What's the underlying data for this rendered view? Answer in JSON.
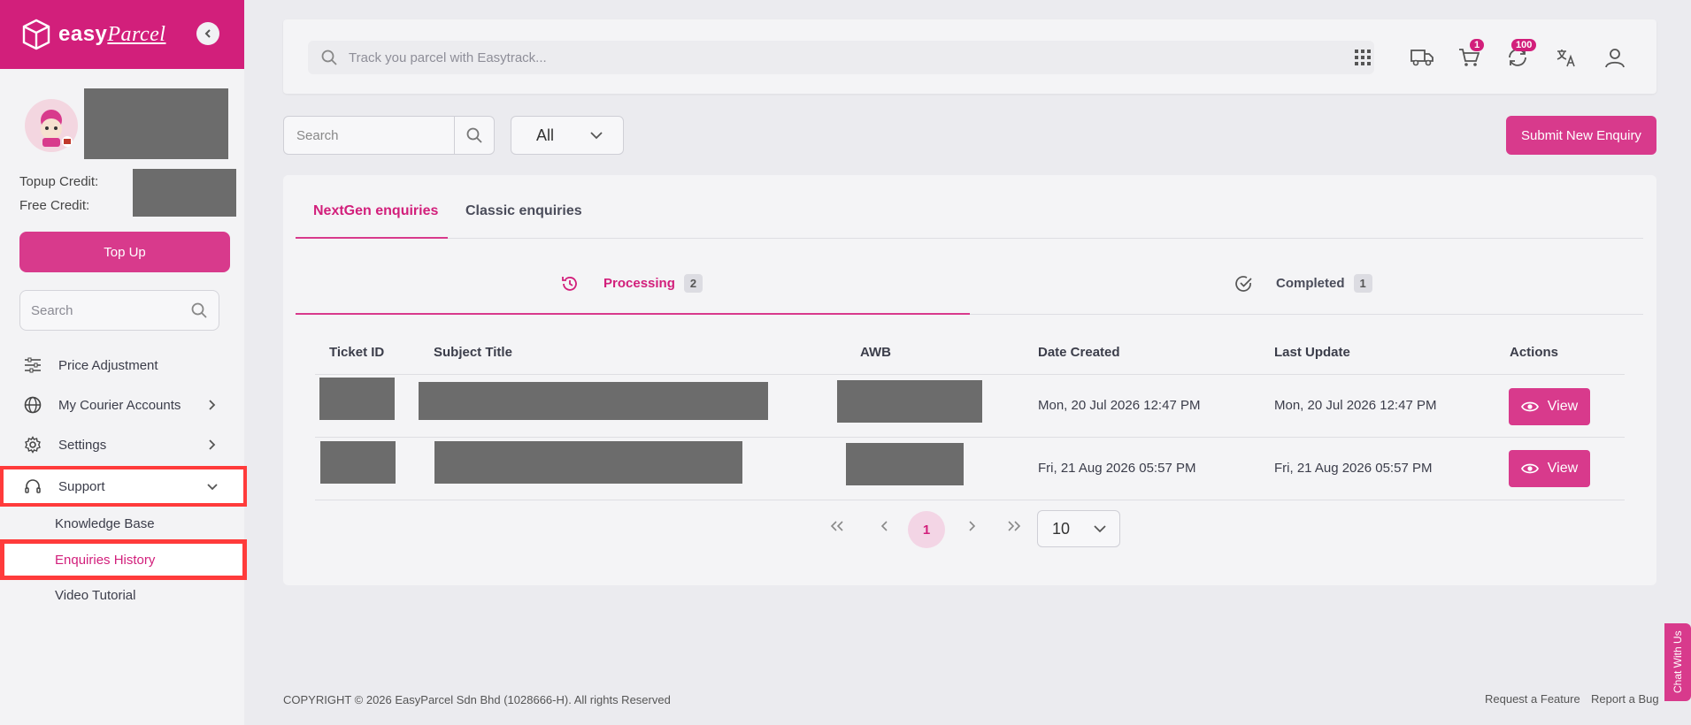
{
  "brand": {
    "name_prefix": "easy",
    "name_suffix": "Parcel"
  },
  "sidebar": {
    "topup_credit_label": "Topup Credit:",
    "free_credit_label": "Free Credit:",
    "topup_button": "Top Up",
    "search_placeholder": "Search",
    "items": [
      {
        "label": "Price Adjustment"
      },
      {
        "label": "My Courier Accounts"
      },
      {
        "label": "Settings"
      },
      {
        "label": "Support"
      }
    ],
    "sub_items": [
      {
        "label": "Knowledge Base"
      },
      {
        "label": "Enquiries History"
      },
      {
        "label": "Video Tutorial"
      }
    ]
  },
  "topbar": {
    "track_placeholder": "Track you parcel with Easytrack...",
    "cart_badge": "1",
    "notif_badge": "100"
  },
  "toolbar": {
    "search_placeholder": "Search",
    "filter_value": "All",
    "submit_button": "Submit New Enquiry"
  },
  "tabs": [
    {
      "label": "NextGen enquiries"
    },
    {
      "label": "Classic enquiries"
    }
  ],
  "subtabs": [
    {
      "label": "Processing",
      "count": "2"
    },
    {
      "label": "Completed",
      "count": "1"
    }
  ],
  "table": {
    "headers": [
      "Ticket ID",
      "Subject Title",
      "AWB",
      "Date Created",
      "Last Update",
      "Actions"
    ],
    "rows": [
      {
        "date_created": "Mon, 20 Jul 2026 12:47 PM",
        "last_update": "Mon, 20 Jul 2026 12:47 PM",
        "action": "View"
      },
      {
        "date_created": "Fri, 21 Aug 2026 05:57 PM",
        "last_update": "Fri, 21 Aug 2026 05:57 PM",
        "action": "View"
      }
    ]
  },
  "pagination": {
    "current": "1",
    "page_size": "10"
  },
  "footer": {
    "copyright": "COPYRIGHT © 2026 EasyParcel Sdn Bhd (1028666-H). All rights Reserved",
    "request_feature": "Request a Feature",
    "report_bug": "Report a Bug"
  },
  "chat": {
    "label": "Chat With Us"
  },
  "colors": {
    "brand": "#d21f7b",
    "accent": "#d83a8c",
    "highlight": "#ff3b3b"
  }
}
